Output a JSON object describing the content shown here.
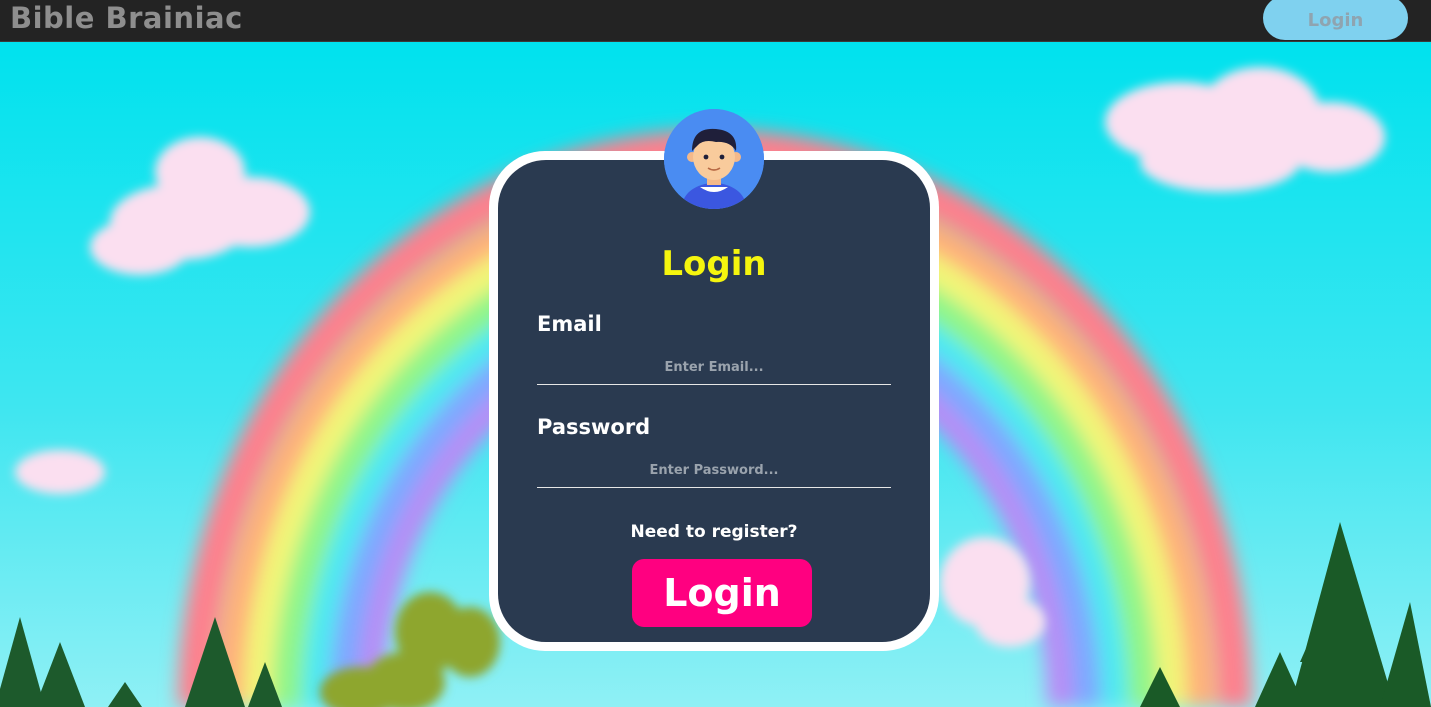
{
  "navbar": {
    "brand": "Bible Brainiac",
    "login_button": "Login"
  },
  "login_card": {
    "avatar_icon": "user-avatar-icon",
    "title": "Login",
    "email": {
      "label": "Email",
      "placeholder": "Enter Email...",
      "value": ""
    },
    "password": {
      "label": "Password",
      "placeholder": "Enter Password...",
      "value": ""
    },
    "register_link": "Need to register?",
    "submit_button": "Login"
  },
  "colors": {
    "navbar_bg": "#232323",
    "nav_button_bg": "#7fd1ef",
    "card_bg": "#2a3a50",
    "title_color": "#f5f50e",
    "submit_bg": "#ff0080",
    "avatar_bg": "#4a8cf2"
  }
}
